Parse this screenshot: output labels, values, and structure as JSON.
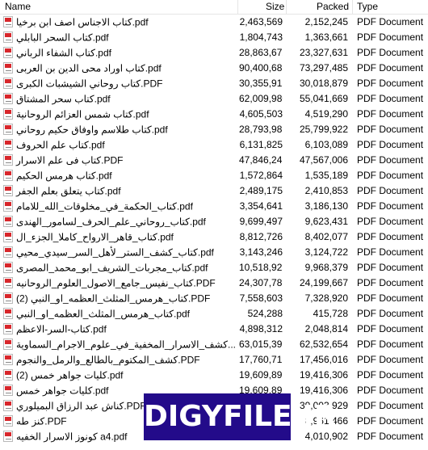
{
  "columns": {
    "name": "Name",
    "size": "Size",
    "packed": "Packed",
    "type": "Type"
  },
  "icon": "pdf-file-icon",
  "files": [
    {
      "name": "كتاب الاجناس اصف ابن برخيا.pdf",
      "size": "2,463,569",
      "packed": "2,152,245",
      "type": "PDF Document"
    },
    {
      "name": "كتاب السحر البابلي.pdf",
      "size": "1,804,743",
      "packed": "1,363,661",
      "type": "PDF Document"
    },
    {
      "name": "كتاب الشفاء الرباني.pdf",
      "size": "28,863,672",
      "packed": "23,327,631",
      "type": "PDF Document"
    },
    {
      "name": "كتاب اوراد محى الدين بن العربى.pdf",
      "size": "90,400,689",
      "packed": "73,297,485",
      "type": "PDF Document"
    },
    {
      "name": "كتاب روحاني الشيشبات الكبرى.PDF",
      "size": "30,355,915",
      "packed": "30,018,879",
      "type": "PDF Document"
    },
    {
      "name": "كتاب سحر المشتاق.pdf",
      "size": "62,009,980",
      "packed": "55,041,669",
      "type": "PDF Document"
    },
    {
      "name": "كتاب شمس العزائم الروحانية.pdf",
      "size": "4,605,503",
      "packed": "4,519,290",
      "type": "PDF Document"
    },
    {
      "name": "كتاب طلاسم واوفاق حكيم روحاني.pdf",
      "size": "28,793,981",
      "packed": "25,799,922",
      "type": "PDF Document"
    },
    {
      "name": "كتاب علم الحروف.pdf",
      "size": "6,131,825",
      "packed": "6,103,089",
      "type": "PDF Document"
    },
    {
      "name": "كتاب فى علم الاسرار.PDF",
      "size": "47,846,247",
      "packed": "47,567,006",
      "type": "PDF Document"
    },
    {
      "name": "كتاب هرمس الحكيم.pdf",
      "size": "1,572,864",
      "packed": "1,535,189",
      "type": "PDF Document"
    },
    {
      "name": "كتاب يتعلق بعلم الجفر.pdf",
      "size": "2,489,175",
      "packed": "2,410,853",
      "type": "PDF Document"
    },
    {
      "name": "كتاب_الحكمة_في_مخلوقات_الله_للامام.pdf",
      "size": "3,354,641",
      "packed": "3,186,130",
      "type": "PDF Document"
    },
    {
      "name": "كتاب_روحاني_علم_الحرف_لسامور_الهندى.pdf",
      "size": "9,699,497",
      "packed": "9,623,431",
      "type": "PDF Document"
    },
    {
      "name": "كتاب_قاهر_الارواح_كاملا_الجزء_ال.pdf",
      "size": "8,812,726",
      "packed": "8,402,077",
      "type": "PDF Document"
    },
    {
      "name": "كتاب_كشف_الستر_لأهل_السر_سيدي_محيي.pdf",
      "size": "3,143,246",
      "packed": "3,124,722",
      "type": "PDF Document"
    },
    {
      "name": "كتاب_مجربات_الشريف_ابو_محمد_المصرى.pdf",
      "size": "10,518,925",
      "packed": "9,968,379",
      "type": "PDF Document"
    },
    {
      "name": "كتاب_نفيس_جامع_الاصول_العلوم_الروحانيه.PDF",
      "size": "24,307,787",
      "packed": "24,199,667",
      "type": "PDF Document"
    },
    {
      "name": "كتاب_هرمس_المثلث_العظمه_او_النبي (2).PDF",
      "size": "7,558,603",
      "packed": "7,328,920",
      "type": "PDF Document"
    },
    {
      "name": "كتاب_هرمس_المثلث_العظمه_او_النبي.pdf",
      "size": "524,288",
      "packed": "415,728",
      "type": "PDF Document"
    },
    {
      "name": "كتاب-السر-الاعظم.pdf",
      "size": "4,898,312",
      "packed": "2,048,814",
      "type": "PDF Document"
    },
    {
      "name": "كشف_الاسرار_المخفية_في_علوم_الاجرام_السماوية...",
      "size": "63,015,399",
      "packed": "62,532,654",
      "type": "PDF Document"
    },
    {
      "name": "كشف_المكتوم_بالطالع_والرمل_والنجوم.PDF",
      "size": "17,760,712",
      "packed": "17,456,016",
      "type": "PDF Document"
    },
    {
      "name": "كليات جواهر خمس (2).pdf",
      "size": "19,609,896",
      "packed": "19,416,306",
      "type": "PDF Document"
    },
    {
      "name": "كليات جواهر خمس.pdf",
      "size": "19,609,896",
      "packed": "19,416,306",
      "type": "PDF Document"
    },
    {
      "name": "كناش عبد الرزاق البميلوري.PDF",
      "size": "",
      "packed": "39,003,929",
      "type": "PDF Document"
    },
    {
      "name": "كنز طه.PDF",
      "size": "",
      "packed": "8,961,466",
      "type": "PDF Document"
    },
    {
      "name": "كونوز الاسرار الخفيه a4.pdf",
      "size": "",
      "packed": "4,010,902",
      "type": "PDF Document"
    }
  ],
  "watermark": {
    "text": "DIGYFILE.IR",
    "background": "#230b8a",
    "color": "#ffffff"
  }
}
